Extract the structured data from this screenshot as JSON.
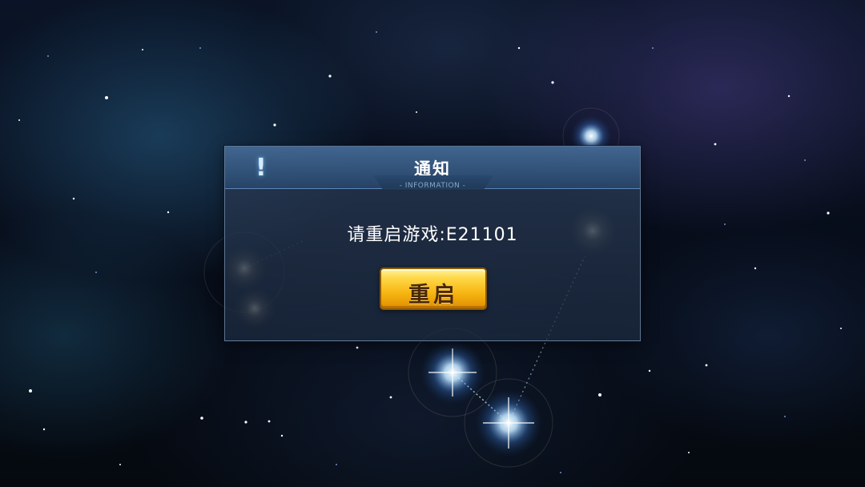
{
  "dialog": {
    "title": "通知",
    "subtitle": "- INFORMATION -",
    "icon": "exclamation-icon",
    "message": "请重启游戏:E21101",
    "button_label": "重启"
  },
  "colors": {
    "button_gold": "#f7b613",
    "dialog_header": "#2e5a8a",
    "star_glow": "#bfe4ff"
  }
}
